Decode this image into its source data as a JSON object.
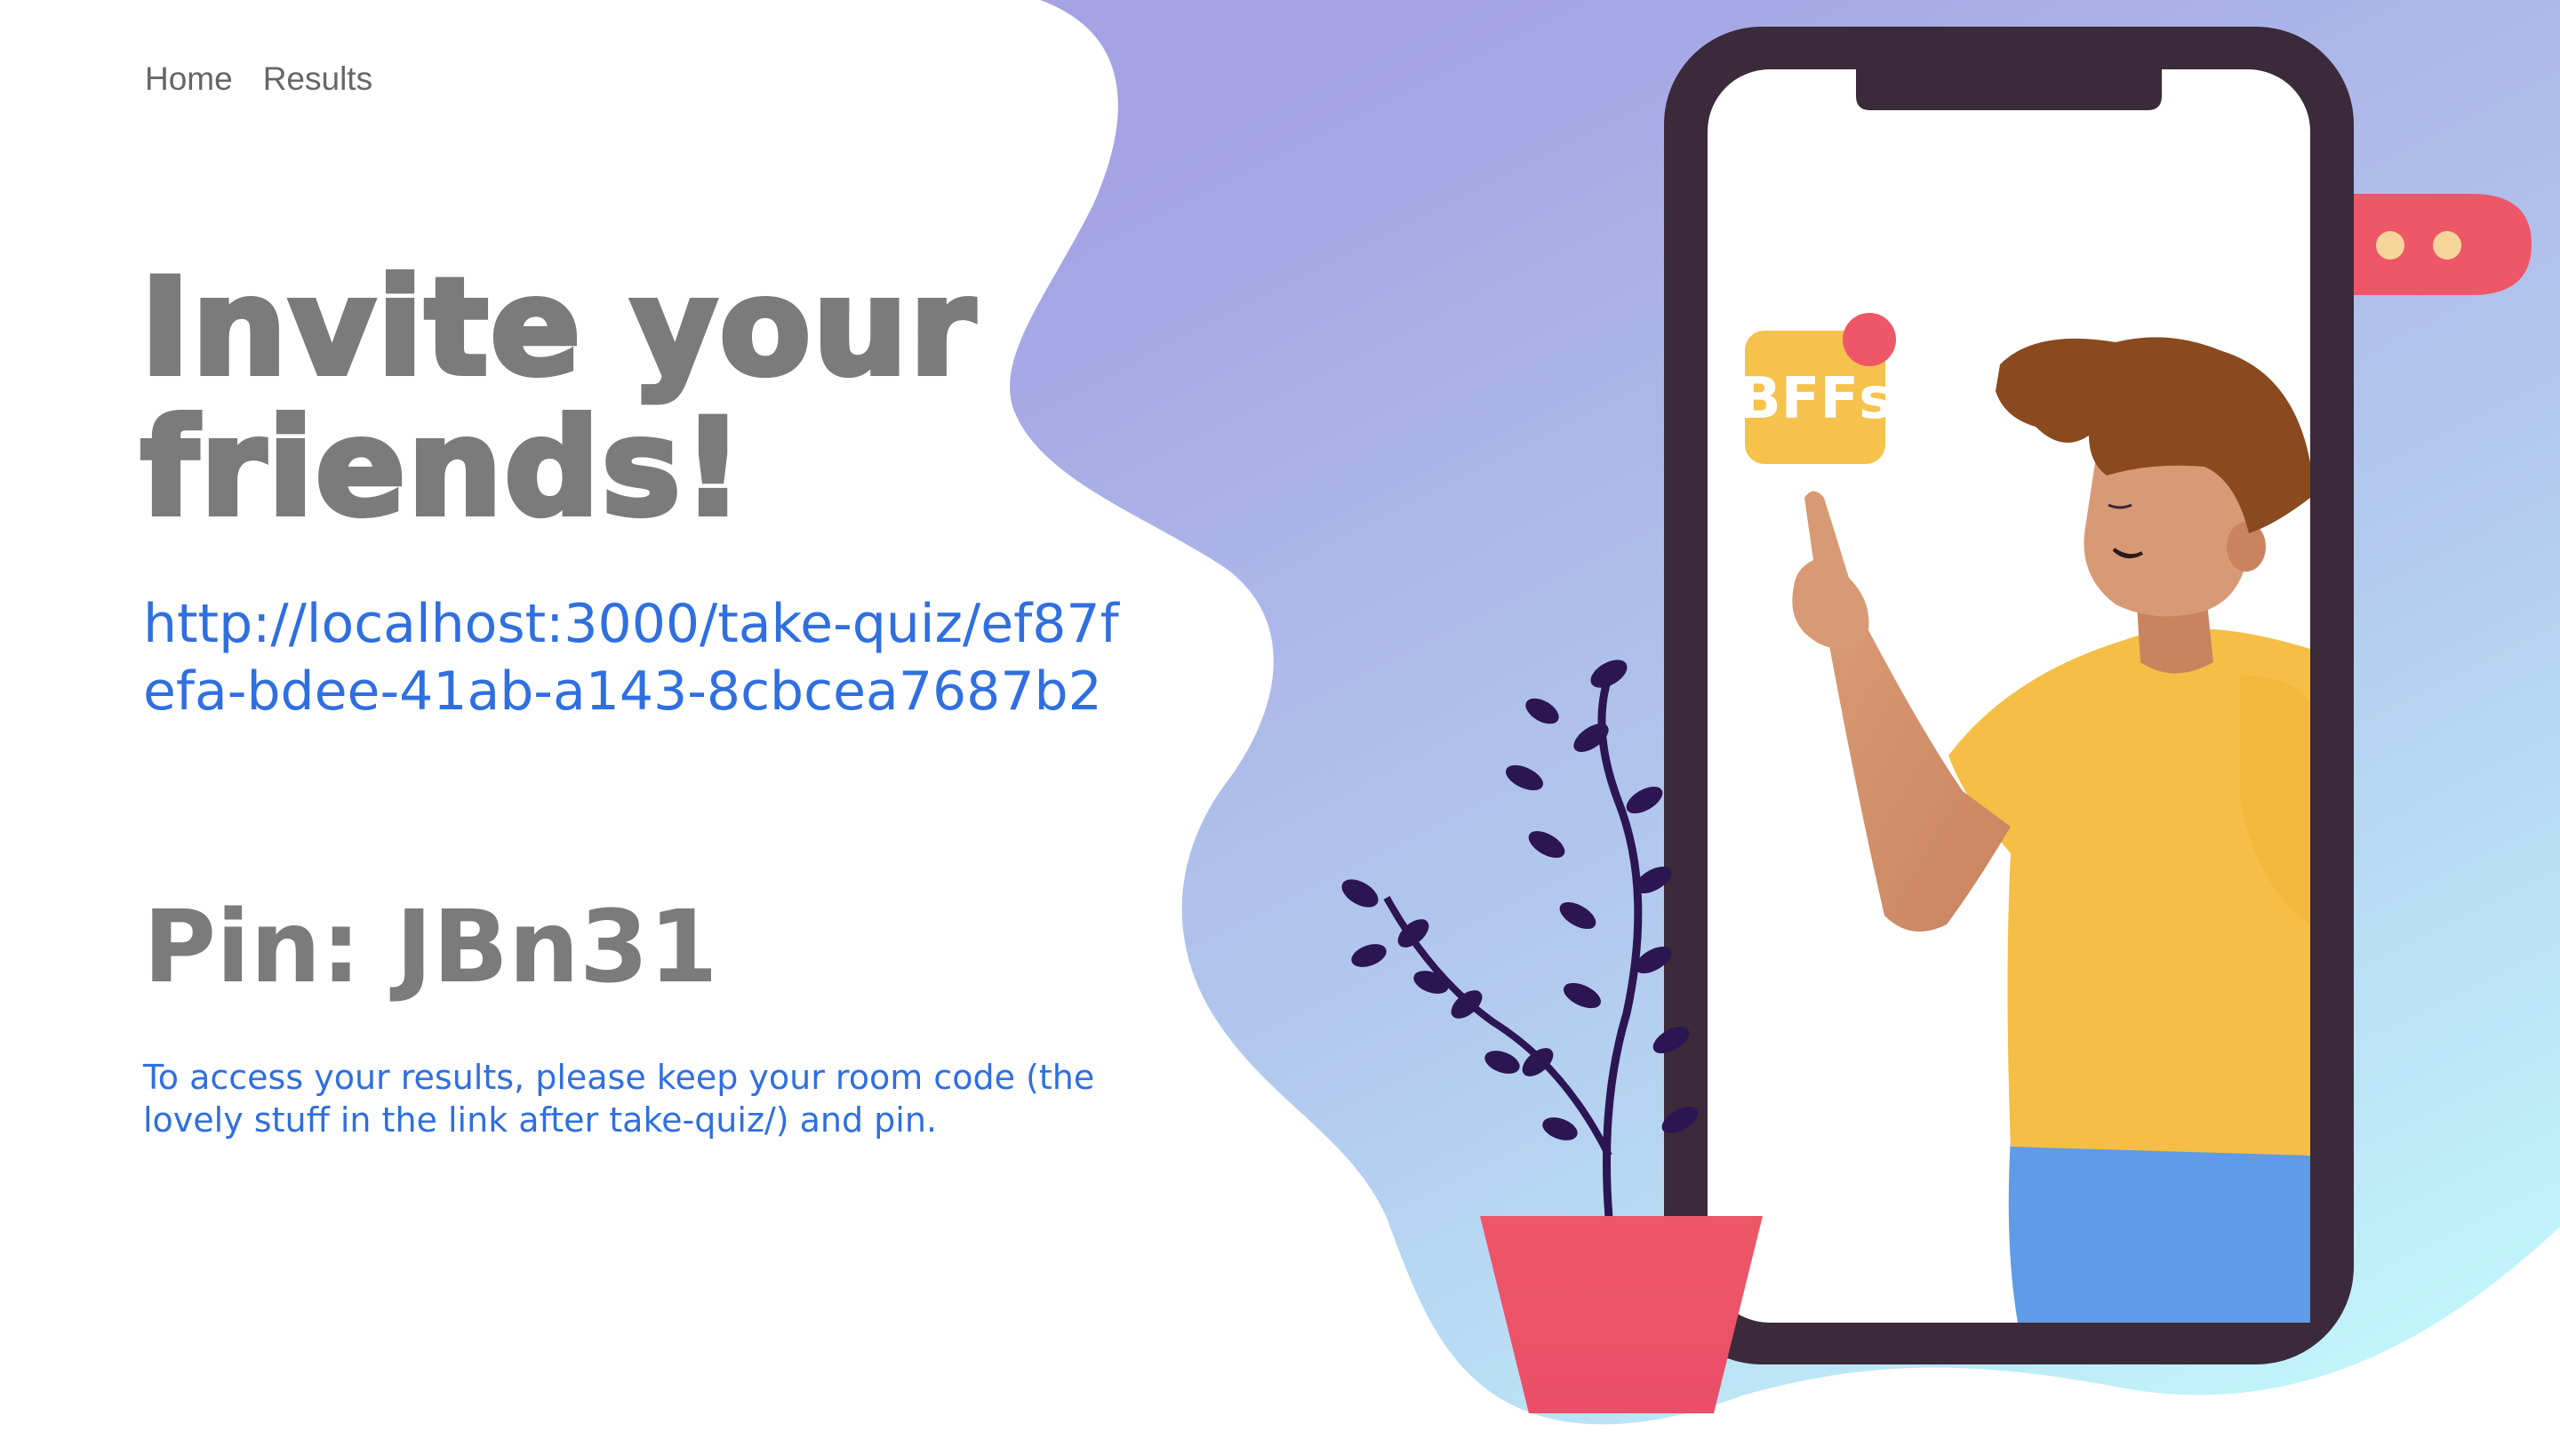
{
  "nav": {
    "items": [
      {
        "label": "Home"
      },
      {
        "label": "Results"
      }
    ]
  },
  "main": {
    "heading_line1": "Invite your",
    "heading_line2": "friends!",
    "invite_url": "http://localhost:3000/take-quiz/ef87fefa-bdee-41ab-a143-8cbcea7687b2",
    "pin_label": "Pin:",
    "pin_value": "JBn31",
    "instructions": "To access your results, please keep your room code (the lovely stuff in the link after take-quiz/) and pin."
  },
  "illustration": {
    "app_badge_text": "BFFs",
    "colors": {
      "gradient_top": "#a5a3e4",
      "gradient_bottom": "#c2f6fc",
      "phone_frame": "#3b2a3a",
      "badge_yellow": "#f5c24c",
      "notification_red": "#ee5767",
      "shirt_yellow": "#f5bf45",
      "pants_blue": "#5f9be6",
      "skin": "#d89a74",
      "hair": "#8a4a1f",
      "plant_purple": "#2c1553",
      "pot_red": "#ee5767",
      "dot_cream": "#f6d59b"
    }
  }
}
